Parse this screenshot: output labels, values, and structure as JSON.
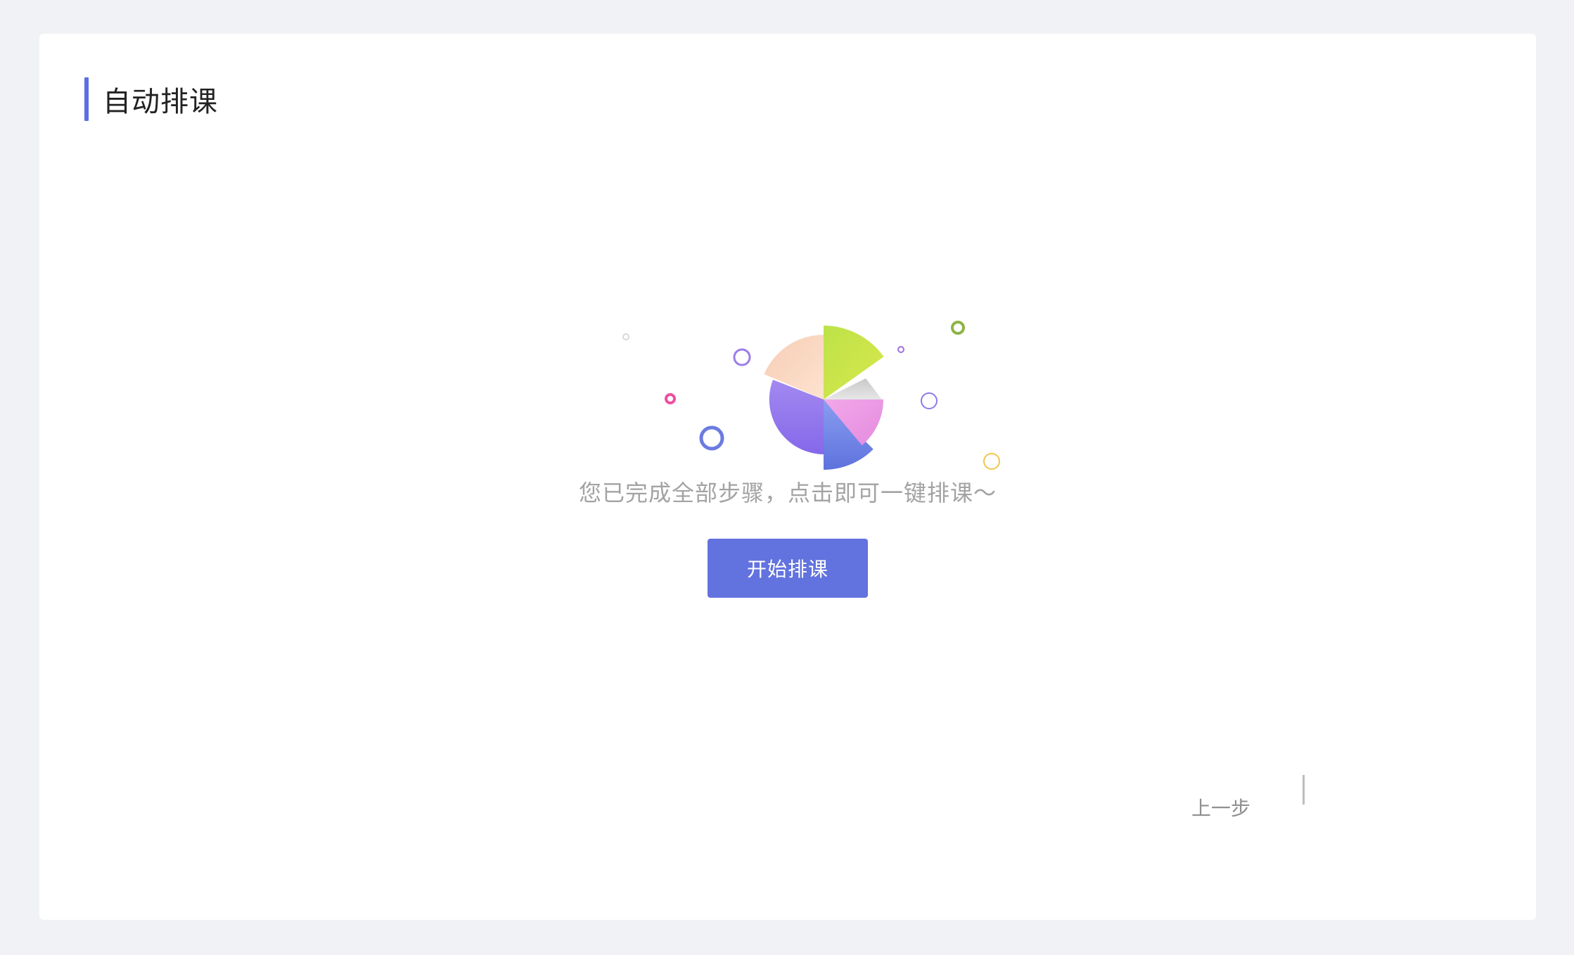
{
  "header": {
    "title": "自动排课"
  },
  "main": {
    "hint": "您已完成全部步骤，点击即可一键排课～",
    "start_button_label": "开始排课",
    "prev_button_label": "上一步"
  },
  "colors": {
    "accent": "#5b6fe0",
    "button": "#6272de",
    "background": "#f0f2f5"
  }
}
